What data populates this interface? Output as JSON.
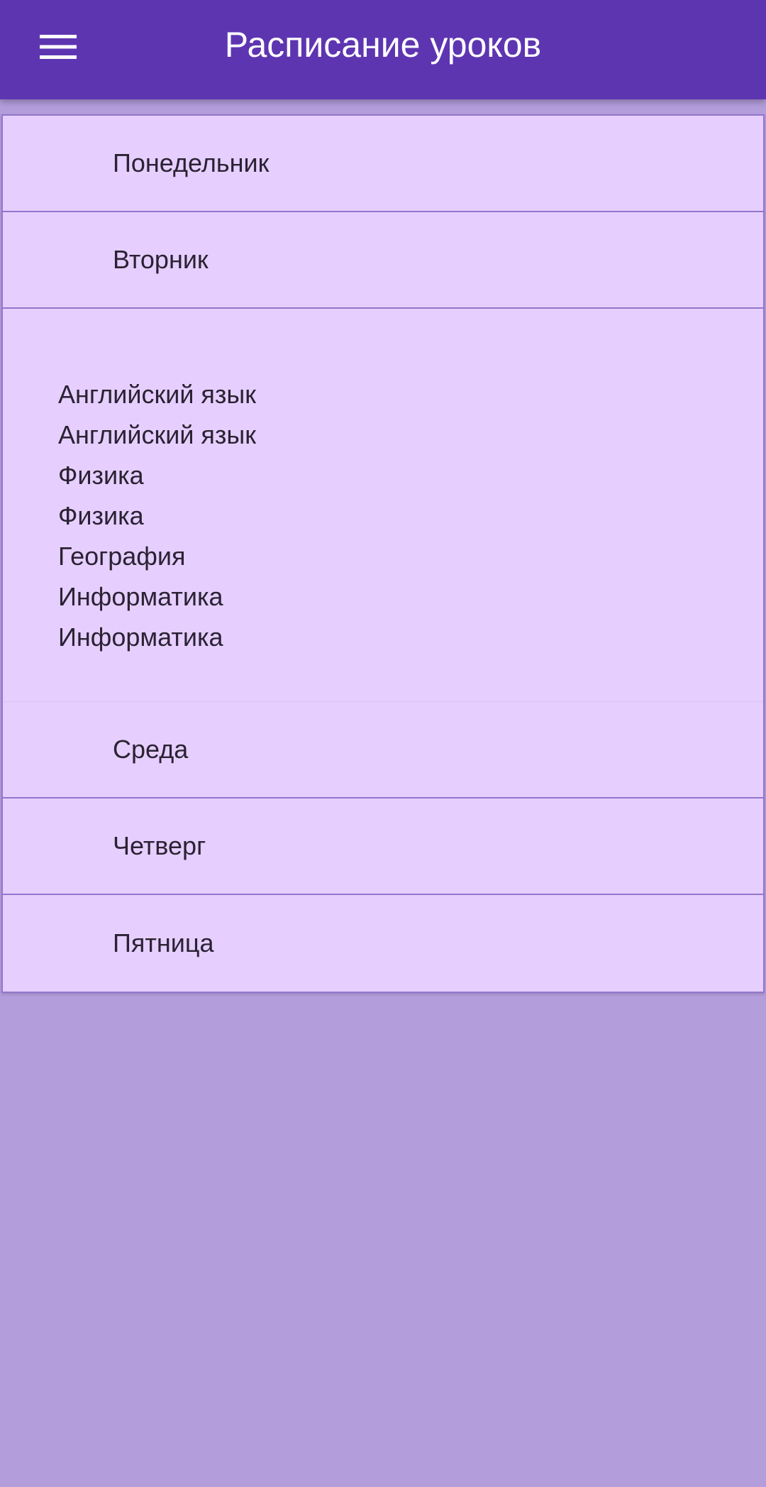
{
  "app_bar": {
    "title": "Расписание уроков",
    "menu_icon": "hamburger-menu-icon"
  },
  "days": [
    {
      "label": "Понедельник"
    },
    {
      "label": "Вторник",
      "expanded": true
    },
    {
      "label": "Среда"
    },
    {
      "label": "Четверг"
    },
    {
      "label": "Пятница"
    }
  ],
  "tuesday_lessons": [
    "Английский язык",
    "Английский язык",
    "Физика",
    "Физика",
    "География",
    "Информатика",
    "Информатика"
  ],
  "colors": {
    "app_bar": "#5e35b1",
    "background": "#b39ddb",
    "list_background": "#e6cfff",
    "divider": "#9575cd",
    "title_text": "#ffffff",
    "item_text": "#2b2233"
  }
}
